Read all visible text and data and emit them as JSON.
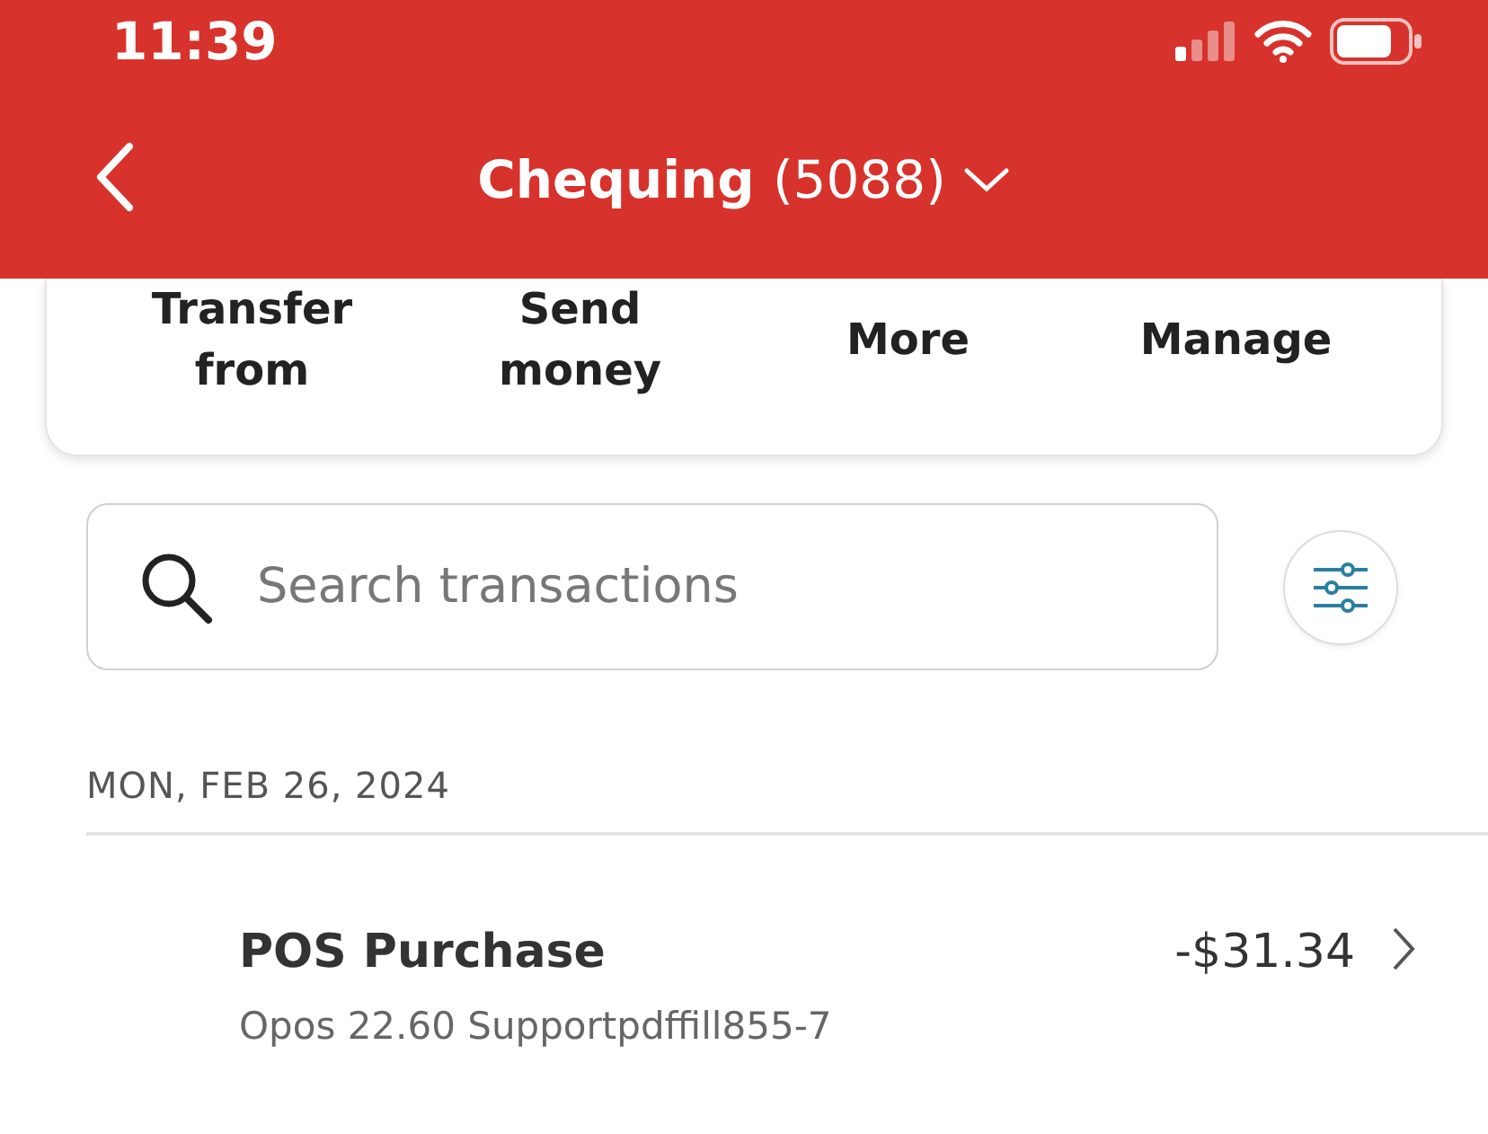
{
  "status_bar": {
    "time": "11:39"
  },
  "header": {
    "title": "Chequing",
    "account": "(5088)"
  },
  "actions": [
    "Transfer from",
    "Send money",
    "More",
    "Manage"
  ],
  "search": {
    "placeholder": "Search transactions"
  },
  "date": "MON, FEB 26, 2024",
  "transactions": [
    {
      "title": "POS Purchase",
      "amount": "-$31.34",
      "description": "Opos 22.60 Supportpdffill855-7"
    }
  ]
}
